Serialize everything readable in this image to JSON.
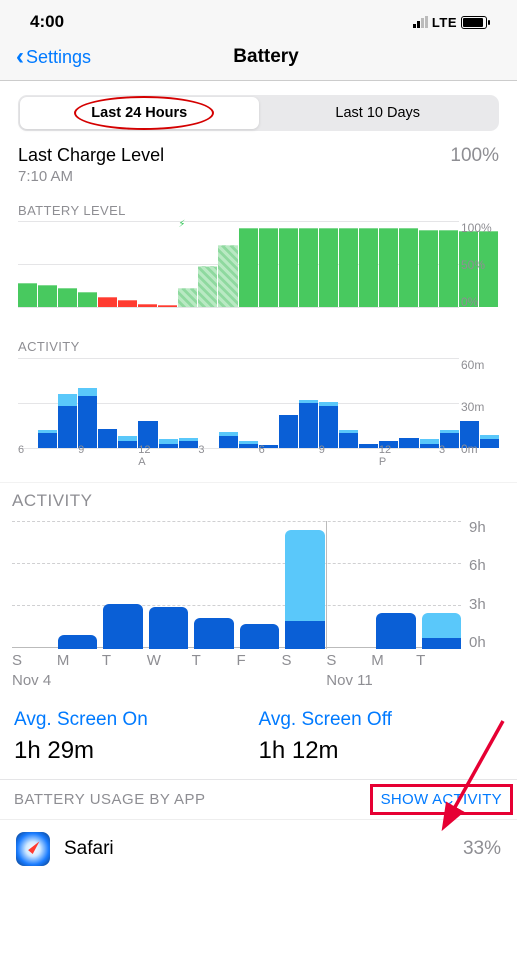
{
  "status": {
    "time": "4:00",
    "network": "LTE"
  },
  "nav": {
    "back": "Settings",
    "title": "Battery"
  },
  "segmented": {
    "tab1": "Last 24 Hours",
    "tab2": "Last 10 Days"
  },
  "last_charge": {
    "title": "Last Charge Level",
    "time": "7:10 AM",
    "percent": "100%"
  },
  "labels": {
    "battery_level": "BATTERY LEVEL",
    "activity_small": "ACTIVITY",
    "activity_big": "ACTIVITY",
    "usage_by_app": "BATTERY USAGE BY APP",
    "show_activity": "SHOW ACTIVITY"
  },
  "chart_data": [
    {
      "type": "bar",
      "title": "BATTERY LEVEL",
      "ylabel": "%",
      "ylim": [
        0,
        100
      ],
      "yticks": [
        "100%",
        "50%",
        "0%"
      ],
      "categories_note": "24 hourly bars approx PM6 → next day PM3",
      "series": [
        {
          "name": "level_pct",
          "values": [
            28,
            26,
            22,
            18,
            12,
            8,
            4,
            2,
            22,
            48,
            72,
            92,
            92,
            92,
            92,
            92,
            92,
            92,
            92,
            92,
            90,
            90,
            88,
            88
          ]
        },
        {
          "name": "state",
          "values": [
            "g",
            "g",
            "g",
            "g",
            "r",
            "r",
            "r",
            "r",
            "h",
            "h",
            "h",
            "g",
            "g",
            "g",
            "g",
            "g",
            "g",
            "g",
            "g",
            "g",
            "g",
            "g",
            "g",
            "g"
          ]
        }
      ],
      "legend": {
        "g": "on battery (green)",
        "r": "low battery (red)",
        "h": "charging (hatched)"
      }
    },
    {
      "type": "bar",
      "title": "ACTIVITY (24h)",
      "ylabel": "minutes",
      "ylim": [
        0,
        60
      ],
      "yticks": [
        "60m",
        "30m",
        "0m"
      ],
      "xticks": [
        "6",
        "",
        "",
        "9",
        "",
        "",
        "12 A",
        "",
        "",
        "3",
        "",
        "",
        "6",
        "",
        "",
        "9",
        "",
        "",
        "12 P",
        "",
        "",
        "3",
        "",
        ""
      ],
      "series": [
        {
          "name": "screen_off_min",
          "values": [
            0,
            2,
            8,
            5,
            0,
            3,
            0,
            3,
            2,
            0,
            3,
            2,
            0,
            0,
            2,
            3,
            2,
            0,
            0,
            0,
            3,
            2,
            0,
            3
          ]
        },
        {
          "name": "screen_on_min",
          "values": [
            0,
            10,
            28,
            35,
            13,
            5,
            18,
            3,
            5,
            0,
            8,
            3,
            2,
            22,
            30,
            28,
            10,
            3,
            5,
            7,
            3,
            10,
            18,
            6
          ]
        }
      ]
    },
    {
      "type": "bar",
      "title": "ACTIVITY (10 days)",
      "ylabel": "hours",
      "ylim": [
        0,
        9
      ],
      "yticks": [
        "9h",
        "6h",
        "3h",
        "0h"
      ],
      "categories": [
        "S",
        "M",
        "T",
        "W",
        "T",
        "F",
        "S",
        "S",
        "M",
        "T"
      ],
      "date_markers": {
        "start": "Nov 4",
        "mid": "Nov 11"
      },
      "series": [
        {
          "name": "screen_off_h",
          "values": [
            0.0,
            0.0,
            0.0,
            0.0,
            0.0,
            0.0,
            6.5,
            0.0,
            0.0,
            1.8
          ]
        },
        {
          "name": "screen_on_h",
          "values": [
            0.0,
            1.0,
            3.2,
            3.0,
            2.2,
            1.8,
            2.0,
            0.0,
            2.6,
            0.8
          ]
        }
      ]
    }
  ],
  "averages": {
    "screen_on_label": "Avg. Screen On",
    "screen_on_value": "1h 29m",
    "screen_off_label": "Avg. Screen Off",
    "screen_off_value": "1h 12m"
  },
  "apps": [
    {
      "name": "Safari",
      "percent": "33%"
    }
  ]
}
